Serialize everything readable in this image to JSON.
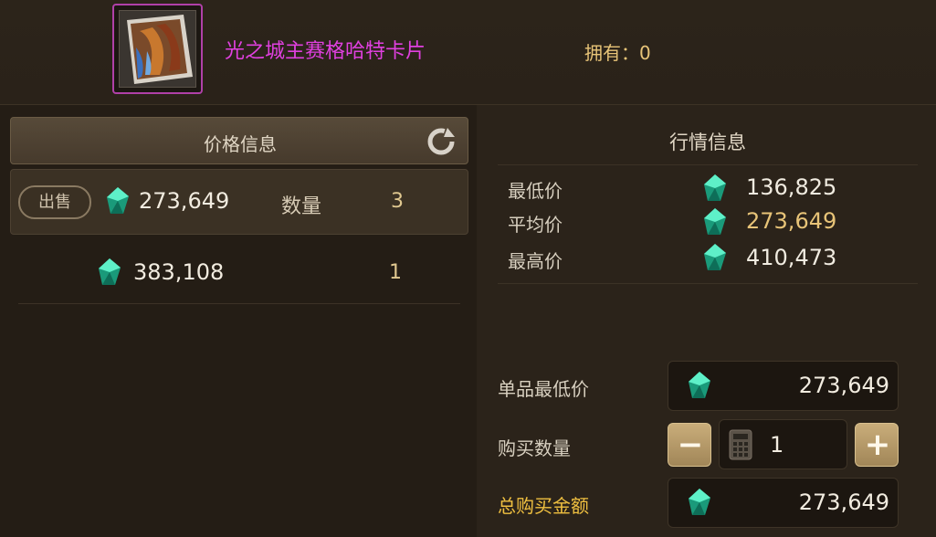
{
  "item": {
    "name": "光之城主赛格哈特卡片",
    "owned_label": "拥有：",
    "owned_value": "0"
  },
  "price_panel": {
    "title": "价格信息",
    "listings": [
      {
        "action_label": "出售",
        "price": "273,649",
        "qty_label": "数量",
        "qty": "3"
      },
      {
        "price": "383,108",
        "qty": "1"
      }
    ]
  },
  "market_panel": {
    "title": "行情信息",
    "stats": [
      {
        "label": "最低价",
        "value": "136,825"
      },
      {
        "label": "平均价",
        "value": "273,649"
      },
      {
        "label": "最高价",
        "value": "410,473"
      }
    ]
  },
  "purchase_form": {
    "unit_price_label": "单品最低价",
    "unit_price": "273,649",
    "quantity_label": "购买数量",
    "quantity": "1",
    "total_label": "总购买金额",
    "total": "273,649"
  },
  "colors": {
    "item_name": "#e040e0",
    "average_price": "#e8c478",
    "total_label": "#f0c040",
    "gem": "#2ec8a0"
  },
  "icons": [
    "card-art",
    "refresh-icon",
    "gem-icon",
    "calculator-icon",
    "minus-icon",
    "plus-icon"
  ]
}
